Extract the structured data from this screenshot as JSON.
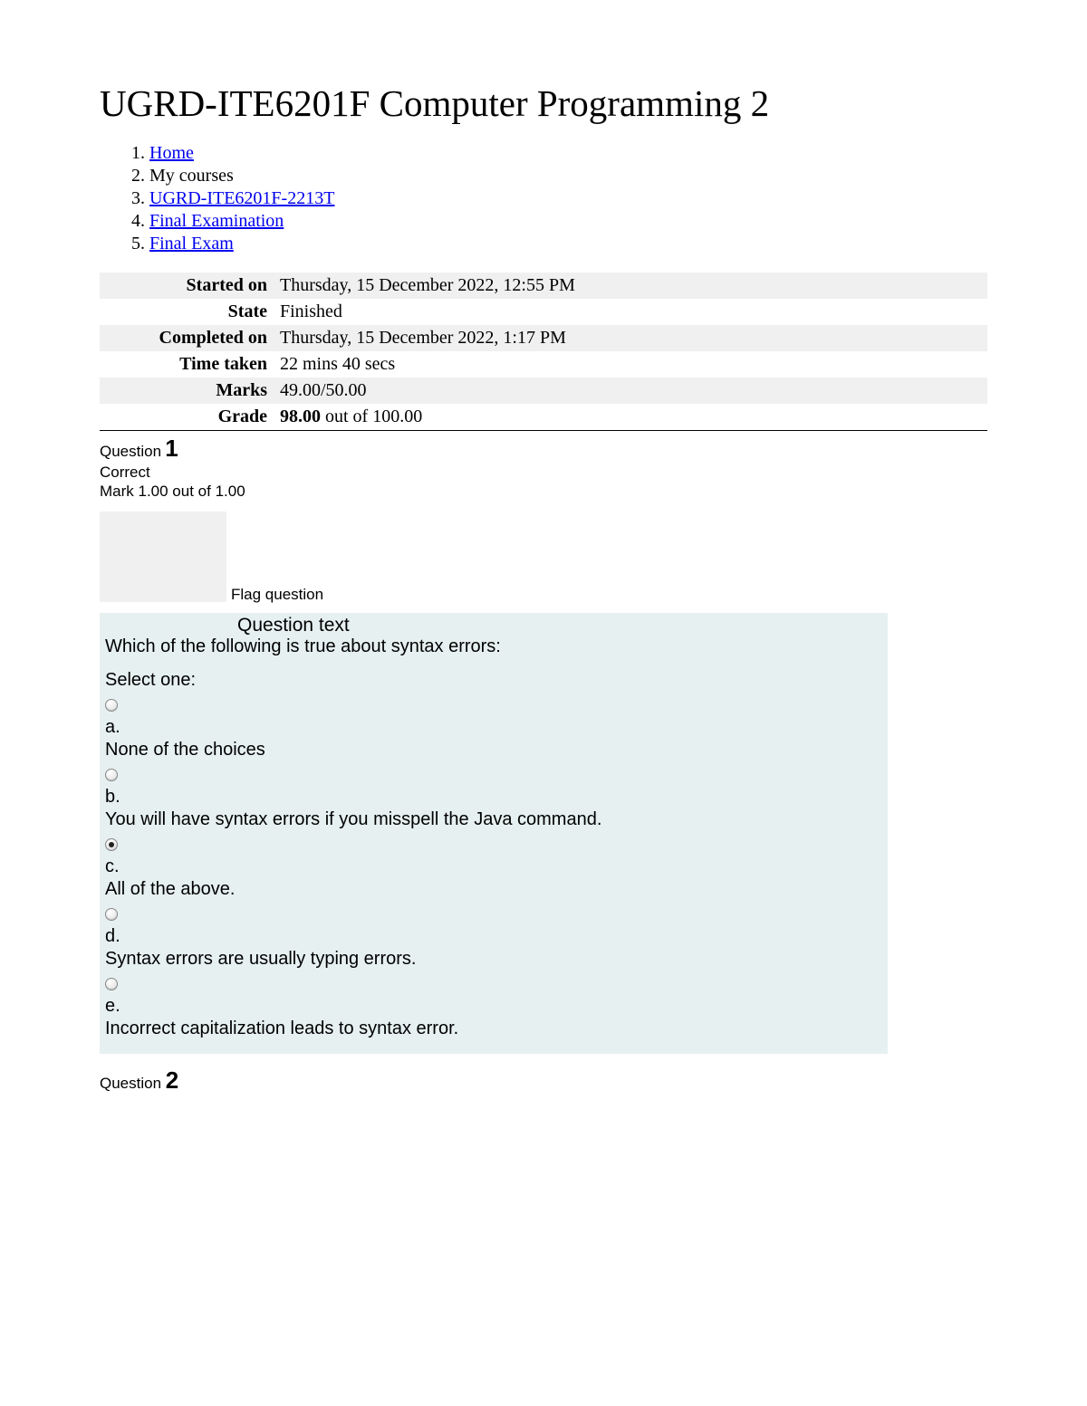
{
  "title": "UGRD-ITE6201F Computer Programming 2",
  "breadcrumb": [
    {
      "label": "Home",
      "link": true
    },
    {
      "label": "My courses",
      "link": false
    },
    {
      "label": "UGRD-ITE6201F-2213T",
      "link": true
    },
    {
      "label": "Final Examination",
      "link": true
    },
    {
      "label": "Final Exam",
      "link": true
    }
  ],
  "summary": {
    "started_on_label": "Started on",
    "started_on_value": "Thursday, 15 December 2022, 12:55 PM",
    "state_label": "State",
    "state_value": "Finished",
    "completed_on_label": "Completed on",
    "completed_on_value": "Thursday, 15 December 2022, 1:17 PM",
    "time_taken_label": "Time taken",
    "time_taken_value": "22 mins 40 secs",
    "marks_label": "Marks",
    "marks_value": "49.00/50.00",
    "grade_label": "Grade",
    "grade_value_bold": "98.00",
    "grade_value_rest": " out of 100.00"
  },
  "question1": {
    "label": "Question",
    "num": "1",
    "correct": "Correct",
    "mark": "Mark 1.00 out of 1.00",
    "flag": "Flag question",
    "heading": "Question text",
    "prompt": "Which of the following is true about syntax errors:",
    "selectone": "Select one:",
    "options": [
      {
        "letter": "a.",
        "text": "None of the choices",
        "selected": false
      },
      {
        "letter": "b.",
        "text": "You will have syntax errors if you misspell the Java command.",
        "selected": false
      },
      {
        "letter": "c.",
        "text": "All of the above.",
        "selected": true
      },
      {
        "letter": "d.",
        "text": "Syntax errors are usually typing errors.",
        "selected": false
      },
      {
        "letter": "e.",
        "text": "Incorrect capitalization leads to syntax error.",
        "selected": false
      }
    ]
  },
  "question2": {
    "label": "Question",
    "num": "2"
  }
}
